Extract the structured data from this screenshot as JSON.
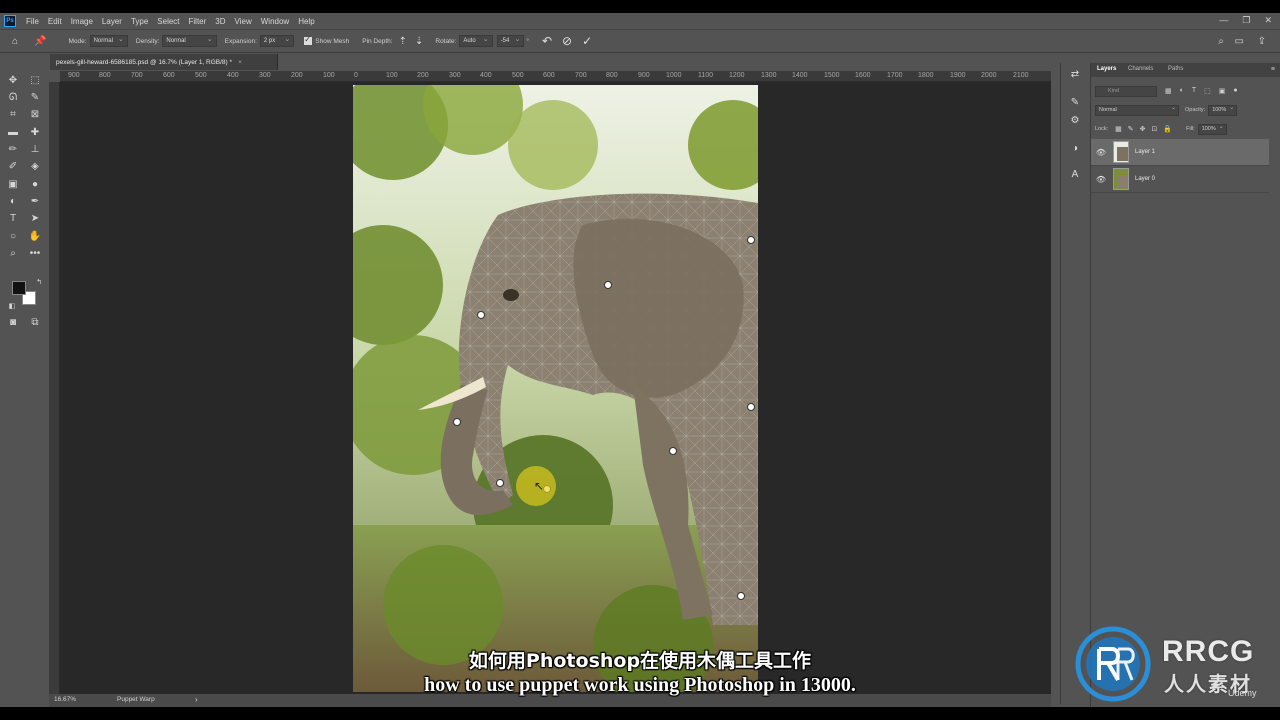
{
  "menu": {
    "logo": "Ps",
    "items": [
      "File",
      "Edit",
      "Image",
      "Layer",
      "Type",
      "Select",
      "Filter",
      "3D",
      "View",
      "Window",
      "Help"
    ]
  },
  "window_controls": [
    "—",
    "❐",
    "✕"
  ],
  "options": {
    "mode_label": "Mode:",
    "mode_value": "Normal",
    "density_label": "Density:",
    "density_value": "Normal",
    "expansion_label": "Expansion:",
    "expansion_value": "2 px",
    "show_mesh_label": "Show Mesh",
    "pin_depth_label": "Pin Depth:",
    "rotate_label": "Rotate:",
    "rotate_mode": "Auto",
    "rotate_value": "-54",
    "rotate_unit": "°"
  },
  "document": {
    "tab_title": "pexels-gill-heward-6586185.psd @ 16.7% (Layer 1, RGB/8) *",
    "close_glyph": "×"
  },
  "ruler": {
    "labels": [
      "900",
      "800",
      "700",
      "600",
      "500",
      "400",
      "300",
      "200",
      "100",
      "0",
      "100",
      "200",
      "300",
      "400",
      "500",
      "600",
      "700",
      "800",
      "900",
      "1000",
      "1100",
      "1200",
      "1300",
      "1400",
      "1500",
      "1600",
      "1700",
      "1800",
      "1900",
      "2000",
      "2100"
    ]
  },
  "status": {
    "zoom": "16.67%",
    "mode": "Puppet Warp",
    "arrow": "›"
  },
  "layers_panel": {
    "tabs": [
      "Layers",
      "Channels",
      "Paths"
    ],
    "active_tab": "Layers",
    "menu_glyph": "≡",
    "kind_placeholder": "Kind",
    "blend_mode": "Normal",
    "opacity_label": "Opacity:",
    "opacity_value": "100%",
    "lock_label": "Lock:",
    "fill_label": "Fill:",
    "fill_value": "100%",
    "layers": [
      {
        "name": "Layer 1",
        "selected": true
      },
      {
        "name": "Layer 0",
        "selected": false
      }
    ]
  },
  "subtitles": {
    "cn": "如何用Photoshop在使用木偶工具工作",
    "en": "how to use puppet work using Photoshop in 13000."
  },
  "watermark": {
    "brand": "RRCG",
    "brand_cn": "人人素材",
    "udemy": "Udemy"
  },
  "colors": {
    "app_bg": "#535353",
    "canvas_bg": "#282828",
    "accent": "#31a8ff"
  }
}
